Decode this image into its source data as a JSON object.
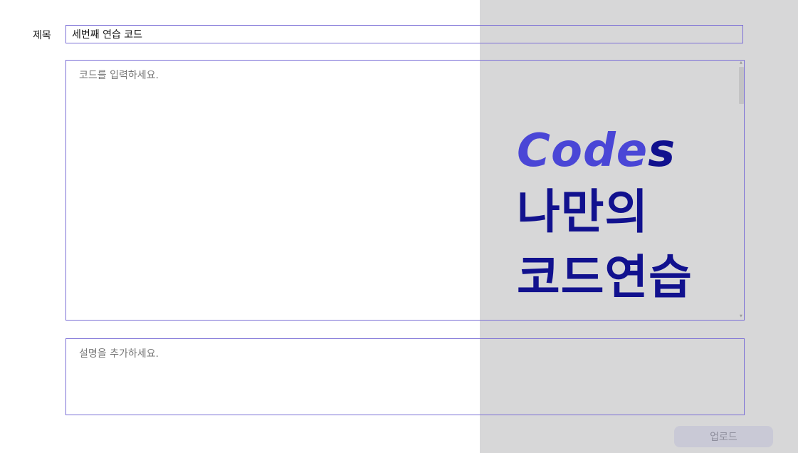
{
  "form": {
    "title_label": "제목",
    "title_value": "세번째 연습 코드",
    "code_placeholder": "코드를 입력하세요.",
    "description_placeholder": "설명을 추가하세요.",
    "upload_label": "업로드"
  },
  "brand": {
    "codes_accent": "Code",
    "codes_dark": "s",
    "line1": "나만의",
    "line2": "코드연습"
  },
  "colors": {
    "accent": "#4a46d6",
    "brand_dark": "#11118e",
    "input_border": "#7b6fd6",
    "panel_gray": "#d7d7d8"
  }
}
